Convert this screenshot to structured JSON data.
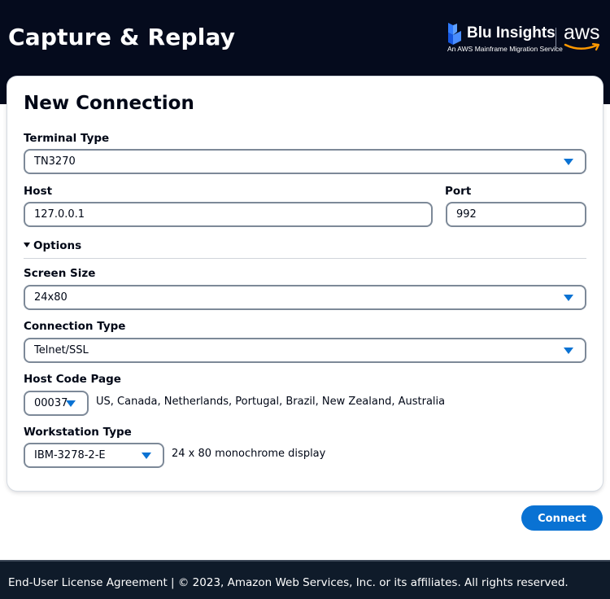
{
  "header": {
    "title": "Capture & Replay",
    "brand_name": "Blu Insights",
    "brand_tagline": "An AWS Mainframe Migration Service",
    "aws_text": "aws"
  },
  "form": {
    "title": "New Connection",
    "terminal_type": {
      "label": "Terminal Type",
      "value": "TN3270"
    },
    "host": {
      "label": "Host",
      "value": "127.0.0.1"
    },
    "port": {
      "label": "Port",
      "value": "992"
    },
    "options_label": "Options",
    "screen_size": {
      "label": "Screen Size",
      "value": "24x80"
    },
    "connection_type": {
      "label": "Connection Type",
      "value": "Telnet/SSL"
    },
    "host_code_page": {
      "label": "Host Code Page",
      "value": "00037",
      "description": "US, Canada, Netherlands, Portugal, Brazil, New Zealand, Australia"
    },
    "workstation_type": {
      "label": "Workstation Type",
      "value": "IBM-3278-2-E",
      "description": "24 x 80 monochrome display"
    }
  },
  "actions": {
    "connect_label": "Connect"
  },
  "footer": {
    "text": "End-User License Agreement | © 2023, Amazon Web Services, Inc. or its affiliates. All rights reserved."
  },
  "colors": {
    "header_bg": "#050b1d",
    "accent": "#0972d3",
    "footer_bg": "#0f1b2a"
  }
}
